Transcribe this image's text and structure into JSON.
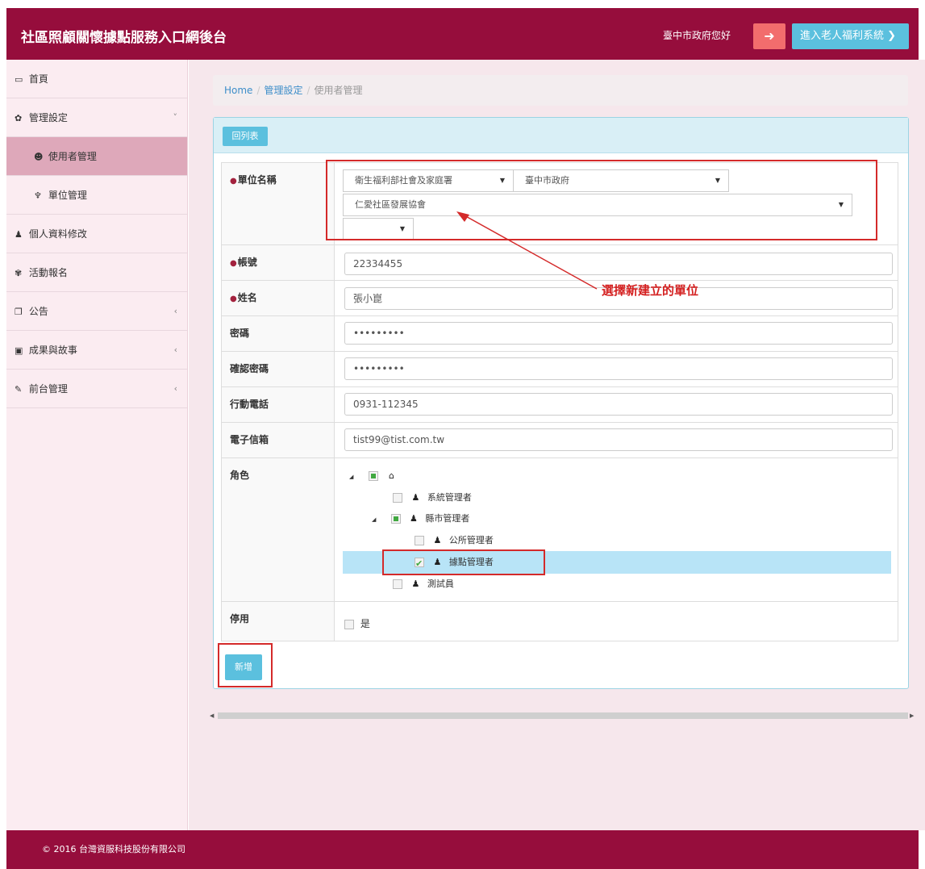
{
  "app": {
    "title": "社區照顧關懷據點服務入口網後台",
    "greeting": "臺中市政府您好",
    "elder_system_label": "進入老人福利系統",
    "brand_color": "#960d3c",
    "accent_color": "#5bc0de"
  },
  "sidebar": {
    "items": [
      {
        "icon": "calendar-icon",
        "glyph": "📅",
        "label": "首頁"
      },
      {
        "icon": "gear-icon",
        "glyph": "✿",
        "label": "管理設定",
        "chevron": "˅"
      },
      {
        "icon": "user-circle-icon",
        "glyph": "☻",
        "label": "使用者管理"
      },
      {
        "icon": "sitemap-icon",
        "glyph": "♆",
        "label": "單位管理"
      },
      {
        "icon": "person-icon",
        "glyph": "♟",
        "label": "個人資料修改"
      },
      {
        "icon": "paw-icon",
        "glyph": "✾",
        "label": "活動報名",
        "chevron": ""
      },
      {
        "icon": "copy-icon",
        "glyph": "❐",
        "label": "公告",
        "chevron": "‹"
      },
      {
        "icon": "image-icon",
        "glyph": "▣",
        "label": "成果與故事",
        "chevron": "‹"
      },
      {
        "icon": "pencil-icon",
        "glyph": "✎",
        "label": "前台管理",
        "chevron": "‹"
      }
    ]
  },
  "breadcrumb": {
    "home": "Home",
    "section": "管理設定",
    "current": "使用者管理"
  },
  "panel": {
    "back_label": "回列表"
  },
  "form": {
    "unit": {
      "label": "單位名稱",
      "select1": "衛生福利部社會及家庭署",
      "select2": "臺中市政府",
      "select3": "仁愛社區發展協會",
      "select4": ""
    },
    "account": {
      "label": "帳號",
      "value": "22334455"
    },
    "name": {
      "label": "姓名",
      "value": "張小崑"
    },
    "password": {
      "label": "密碼",
      "value": "•••••••••"
    },
    "confirm_password": {
      "label": "確認密碼",
      "value": "•••••••••"
    },
    "mobile": {
      "label": "行動電話",
      "value": "0931-112345"
    },
    "email": {
      "label": "電子信箱",
      "value": "tist99@tist.com.tw"
    },
    "role": {
      "label": "角色",
      "tree": [
        {
          "name": "系統管理者",
          "state": "unchecked"
        },
        {
          "name": "縣市管理者",
          "state": "partial"
        },
        {
          "name": "公所管理者",
          "state": "unchecked"
        },
        {
          "name": "據點管理者",
          "state": "checked"
        },
        {
          "name": "測試員",
          "state": "unchecked"
        }
      ]
    },
    "disabled": {
      "label": "停用",
      "option": "是",
      "checked": false
    },
    "required_marker": "●",
    "submit_label": "新增"
  },
  "annotation": {
    "text": "選擇新建立的單位",
    "color": "#d42020"
  },
  "footer": {
    "copyright": "© 2016 台灣資服科技股份有限公司"
  }
}
